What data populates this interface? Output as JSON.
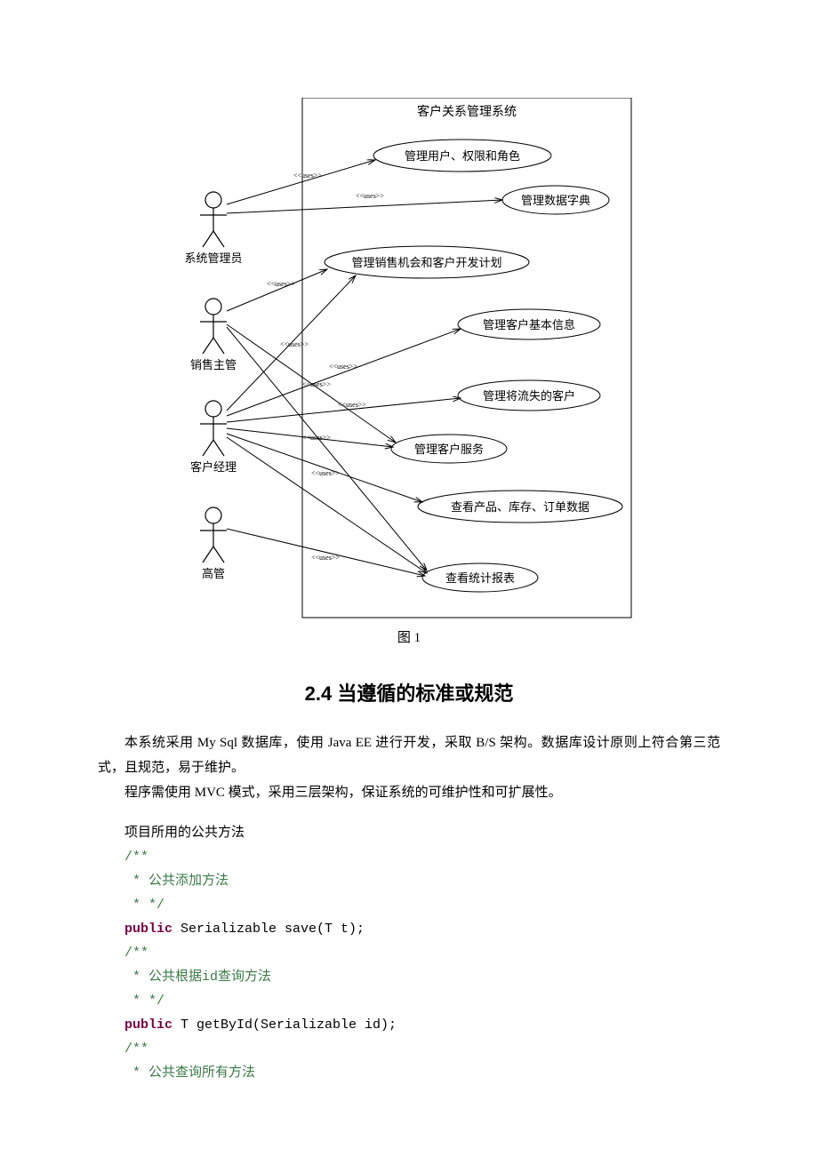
{
  "diagram": {
    "title": "客户关系管理系统",
    "actors": [
      {
        "id": "admin",
        "label": "系统管理员"
      },
      {
        "id": "salesSup",
        "label": "销售主管"
      },
      {
        "id": "custMgr",
        "label": "客户经理"
      },
      {
        "id": "exec",
        "label": "高管"
      }
    ],
    "usecases": [
      {
        "id": "uc1",
        "label": "管理用户、权限和角色"
      },
      {
        "id": "uc2",
        "label": "管理数据字典"
      },
      {
        "id": "uc3",
        "label": "管理销售机会和客户开发计划"
      },
      {
        "id": "uc4",
        "label": "管理客户基本信息"
      },
      {
        "id": "uc5",
        "label": "管理将流失的客户"
      },
      {
        "id": "uc6",
        "label": "管理客户服务"
      },
      {
        "id": "uc7",
        "label": "查看产品、库存、订单数据"
      },
      {
        "id": "uc8",
        "label": "查看统计报表"
      }
    ],
    "stereotype": "<<uses>>",
    "caption": "图 1"
  },
  "heading": "2.4  当遵循的标准或规范",
  "paragraphs": {
    "p1": "本系统采用 My Sql 数据库，使用 Java EE 进行开发，采取 B/S 架构。数据库设计原则上符合第三范式，且规范，易于维护。",
    "p2": "程序需使用 MVC 模式，采用三层架构，保证系统的可维护性和可扩展性。"
  },
  "code": {
    "label": "项目所用的公共方法",
    "c1_open": "/**",
    "c1_l1": " * 公共添加方法",
    "c1_l2": " * */",
    "sig1_kw": "public",
    "sig1_rest": " Serializable save(T t);",
    "c2_open": "/**",
    "c2_l1": " * 公共根据id查询方法",
    "c2_l2": " * */",
    "sig2_kw": "public",
    "sig2_rest": " T getById(Serializable id);",
    "c3_open": "/**",
    "c3_l1": " * 公共查询所有方法"
  }
}
